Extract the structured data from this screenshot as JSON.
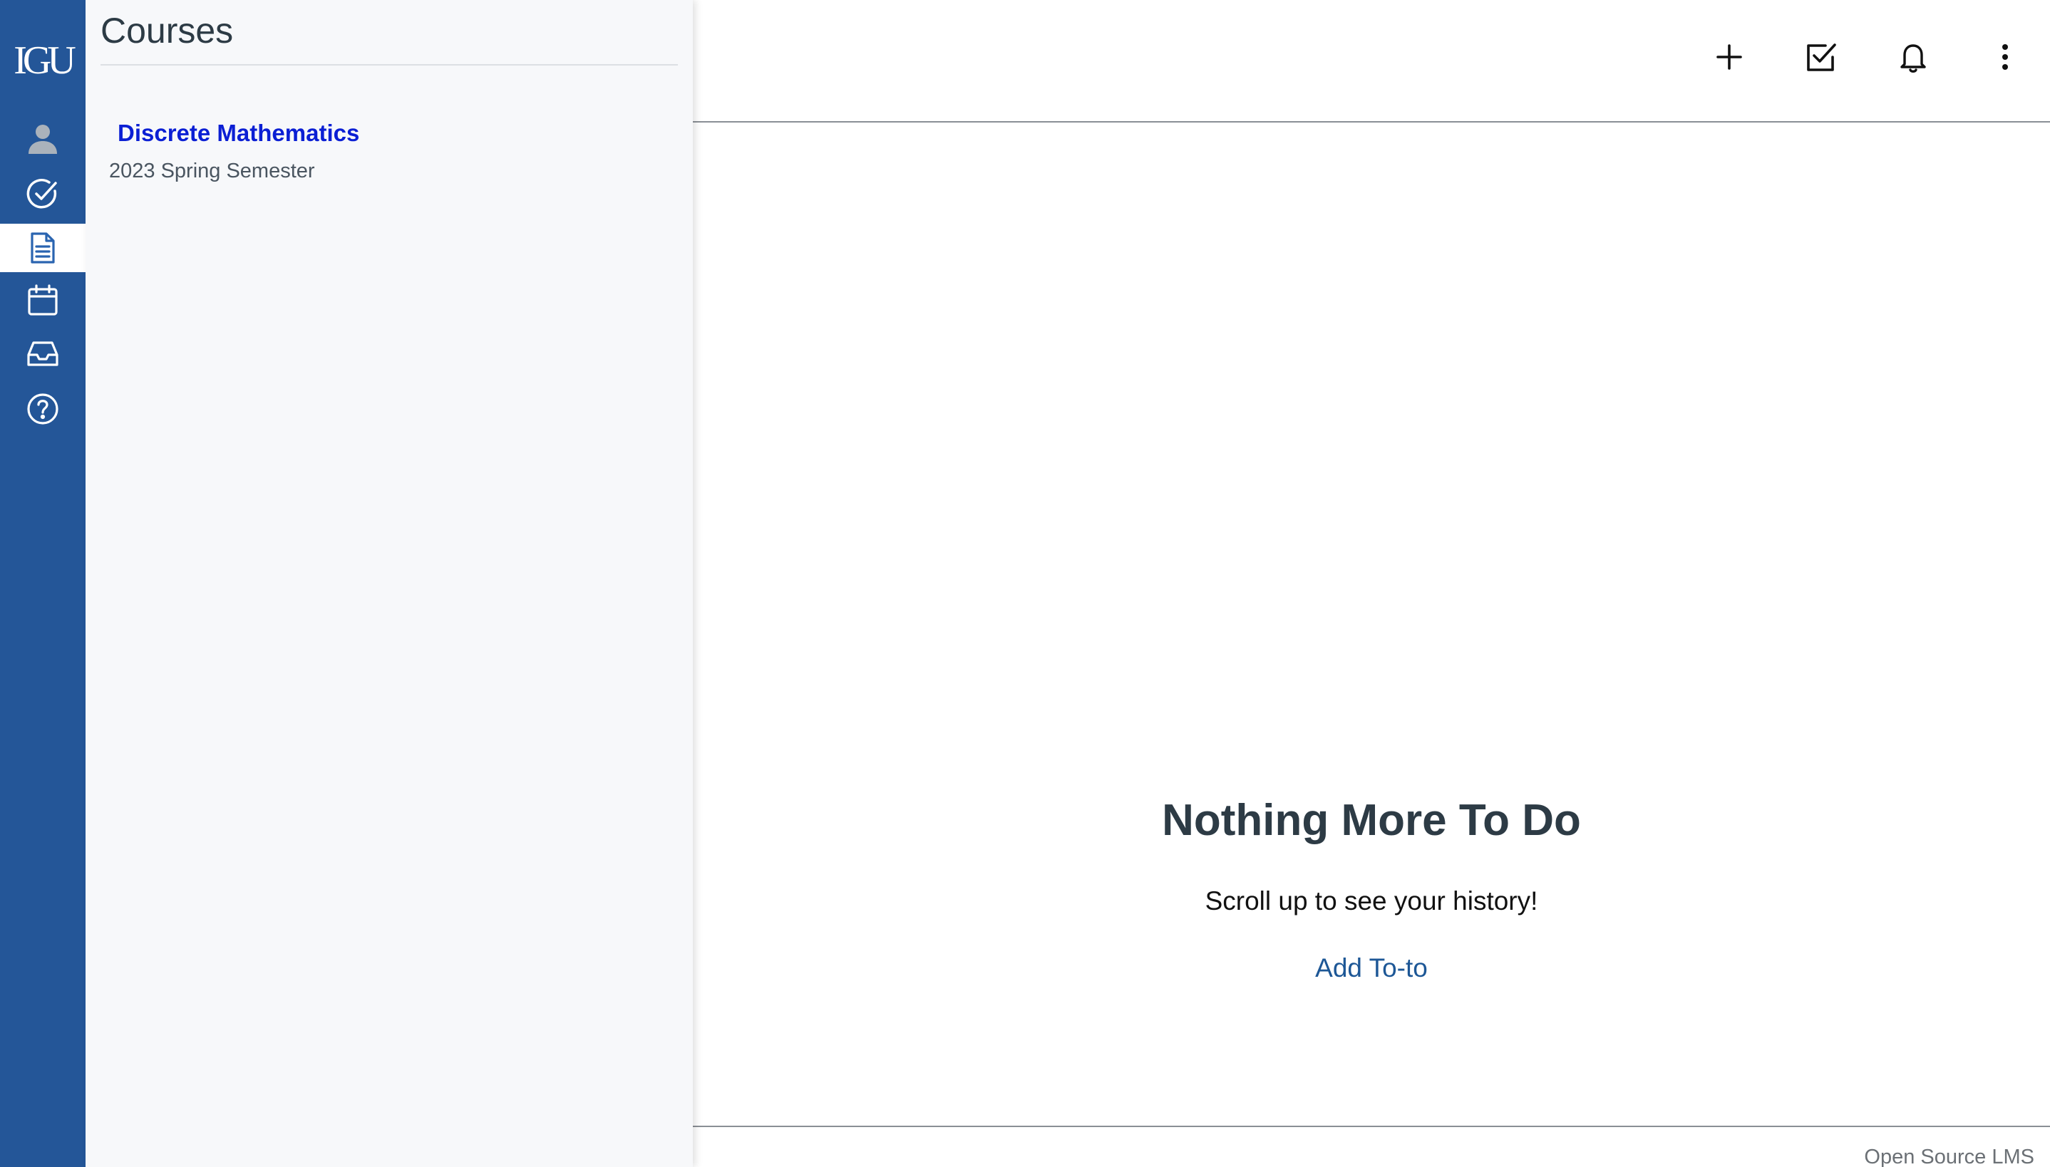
{
  "brand": {
    "logo_text": "IGU",
    "rail_color": "#245698"
  },
  "rail": {
    "items": [
      {
        "icon": "user-icon"
      },
      {
        "icon": "check-circle-icon"
      },
      {
        "icon": "document-icon",
        "active": true
      },
      {
        "icon": "calendar-icon"
      },
      {
        "icon": "inbox-icon"
      },
      {
        "icon": "help-icon"
      }
    ]
  },
  "tray": {
    "title": "Courses",
    "courses": [
      {
        "name": "Discrete Mathematics",
        "term": "2023 Spring Semester"
      }
    ]
  },
  "toolbar": {
    "icons": [
      "plus-icon",
      "checkbox-icon",
      "bell-icon",
      "more-vertical-icon"
    ]
  },
  "empty_state": {
    "title": "Nothing More To Do",
    "subtitle": "Scroll up to see your history!",
    "action_label": "Add To-to",
    "action_color": "#1d5796"
  },
  "footer": {
    "text": "Open Source LMS"
  }
}
